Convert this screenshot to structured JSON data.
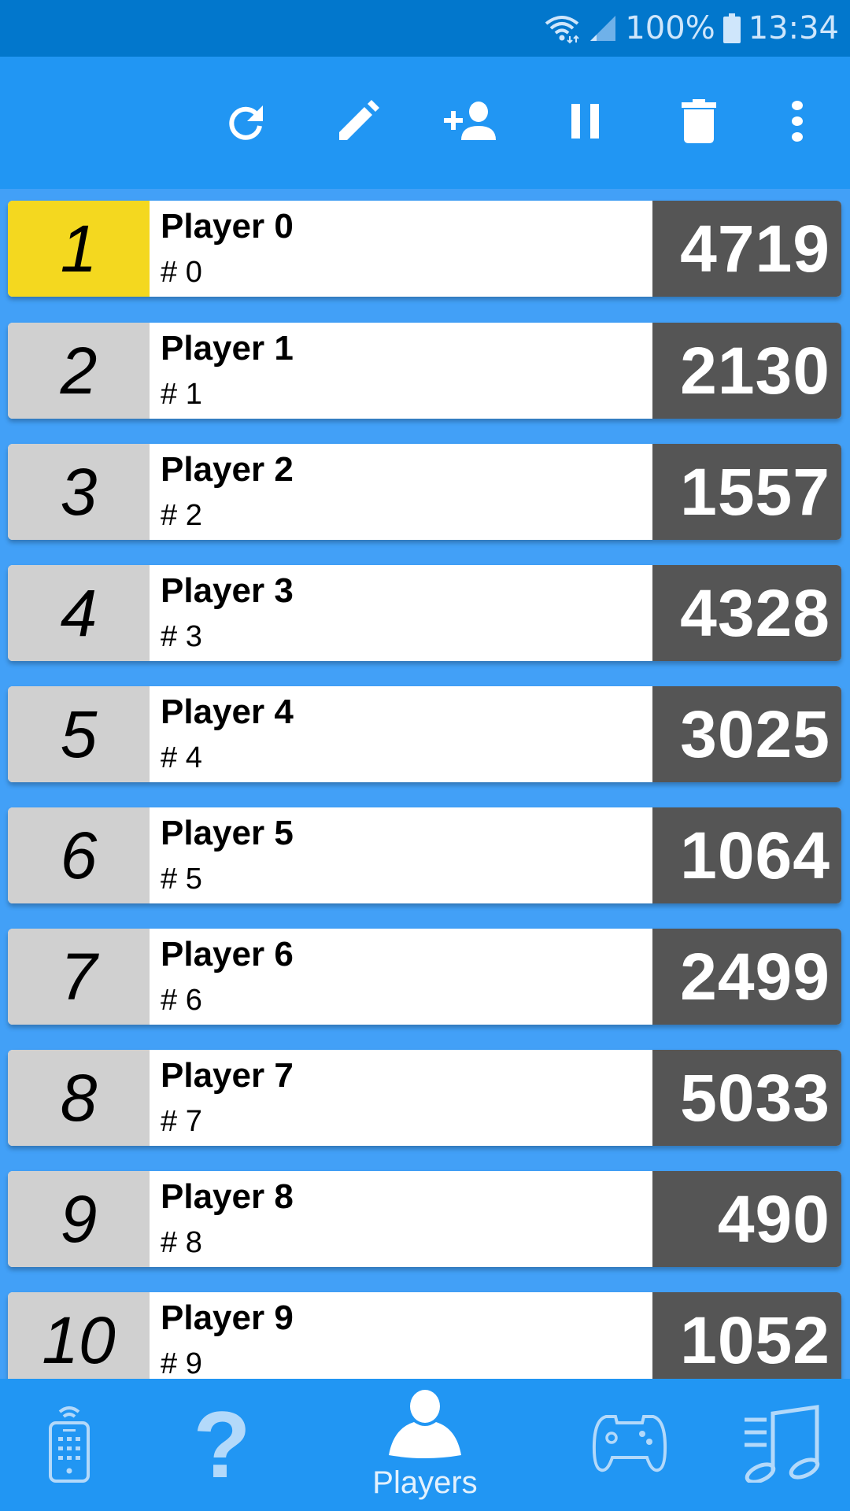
{
  "status_bar": {
    "battery": "100%",
    "time": "13:34",
    "icons": [
      "wifi-icon",
      "signal-icon",
      "battery-icon"
    ]
  },
  "toolbar": {
    "actions": [
      {
        "name": "refresh",
        "icon": "refresh-icon"
      },
      {
        "name": "edit",
        "icon": "pencil-icon"
      },
      {
        "name": "add-player",
        "icon": "add-person-icon"
      },
      {
        "name": "pause",
        "icon": "pause-icon"
      },
      {
        "name": "delete",
        "icon": "trash-icon"
      },
      {
        "name": "more",
        "icon": "more-vert-icon"
      }
    ]
  },
  "colors": {
    "status_bar": "#0277cc",
    "primary": "#2196f3",
    "list_bg": "#42a0f7",
    "first_place": "#f4d81f",
    "rank_bg": "#d0d0d0",
    "score_bg": "#555555"
  },
  "players": [
    {
      "rank": "1",
      "name": "Player 0",
      "id": "# 0",
      "score": "4719"
    },
    {
      "rank": "2",
      "name": "Player 1",
      "id": "# 1",
      "score": "2130"
    },
    {
      "rank": "3",
      "name": "Player 2",
      "id": "# 2",
      "score": "1557"
    },
    {
      "rank": "4",
      "name": "Player 3",
      "id": "# 3",
      "score": "4328"
    },
    {
      "rank": "5",
      "name": "Player 4",
      "id": "# 4",
      "score": "3025"
    },
    {
      "rank": "6",
      "name": "Player 5",
      "id": "# 5",
      "score": "1064"
    },
    {
      "rank": "7",
      "name": "Player 6",
      "id": "# 6",
      "score": "2499"
    },
    {
      "rank": "8",
      "name": "Player 7",
      "id": "# 7",
      "score": "5033"
    },
    {
      "rank": "9",
      "name": "Player 8",
      "id": "# 8",
      "score": "490"
    },
    {
      "rank": "10",
      "name": "Player 9",
      "id": "# 9",
      "score": "1052"
    }
  ],
  "bottom_nav": {
    "items": [
      {
        "name": "remote",
        "icon": "remote-icon",
        "label": ""
      },
      {
        "name": "help",
        "icon": "question-icon",
        "label": ""
      },
      {
        "name": "players",
        "icon": "person-icon",
        "label": "Players",
        "active": true
      },
      {
        "name": "game",
        "icon": "gamepad-icon",
        "label": ""
      },
      {
        "name": "music",
        "icon": "music-icon",
        "label": ""
      }
    ]
  }
}
